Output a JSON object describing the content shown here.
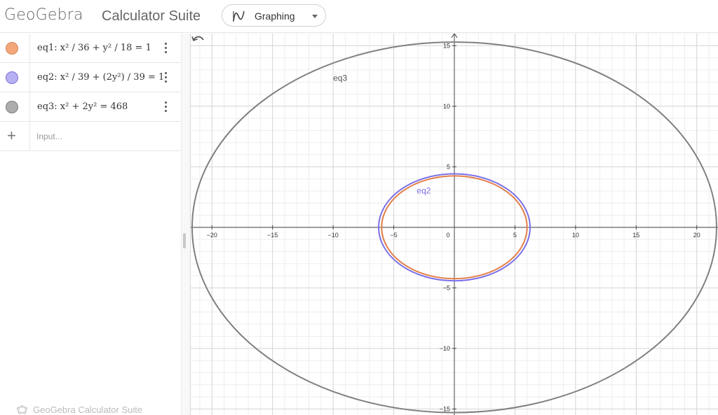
{
  "header": {
    "logo": "GeoGebra",
    "suite_title": "Calculator Suite",
    "app_switcher": {
      "label": "Graphing",
      "icon": "graphing-icon"
    }
  },
  "algebra": {
    "items": [
      {
        "name": "eq1",
        "expression": "eq1: x² / 36 + y² / 18 = 1",
        "color": "#F4A87A",
        "stroke": "#D2855A"
      },
      {
        "name": "eq2",
        "expression": "eq2: x² / 39 + (2y²) / 39 = 1",
        "color": "#B7B0F2",
        "stroke": "#7E73D8"
      },
      {
        "name": "eq3",
        "expression": "eq3: x² + 2y² = 468",
        "color": "#ADADAD",
        "stroke": "#7D7D7D"
      }
    ],
    "input_placeholder": "Input..."
  },
  "footer": {
    "brand": "GeoGebra Calculator Suite"
  },
  "graph": {
    "xaxis": {
      "range": [
        -21.75,
        21.75
      ],
      "ticks": [
        -20,
        -15,
        -10,
        -5,
        0,
        5,
        10,
        15,
        20
      ]
    },
    "yaxis": {
      "range": [
        -15.5,
        16
      ],
      "ticks": [
        -15,
        -10,
        -5,
        5,
        10,
        15
      ]
    },
    "grid": true,
    "curves": [
      {
        "name": "eq1",
        "a": 6,
        "b": 4.243,
        "color": "#E2804A",
        "show_label": false
      },
      {
        "name": "eq2",
        "a": 6.245,
        "b": 4.416,
        "color": "#7B70E8",
        "show_label": true,
        "label": "eq2"
      },
      {
        "name": "eq3",
        "a": 21.633,
        "b": 15.297,
        "color": "#808080",
        "show_label": true,
        "label": "eq3"
      }
    ]
  }
}
